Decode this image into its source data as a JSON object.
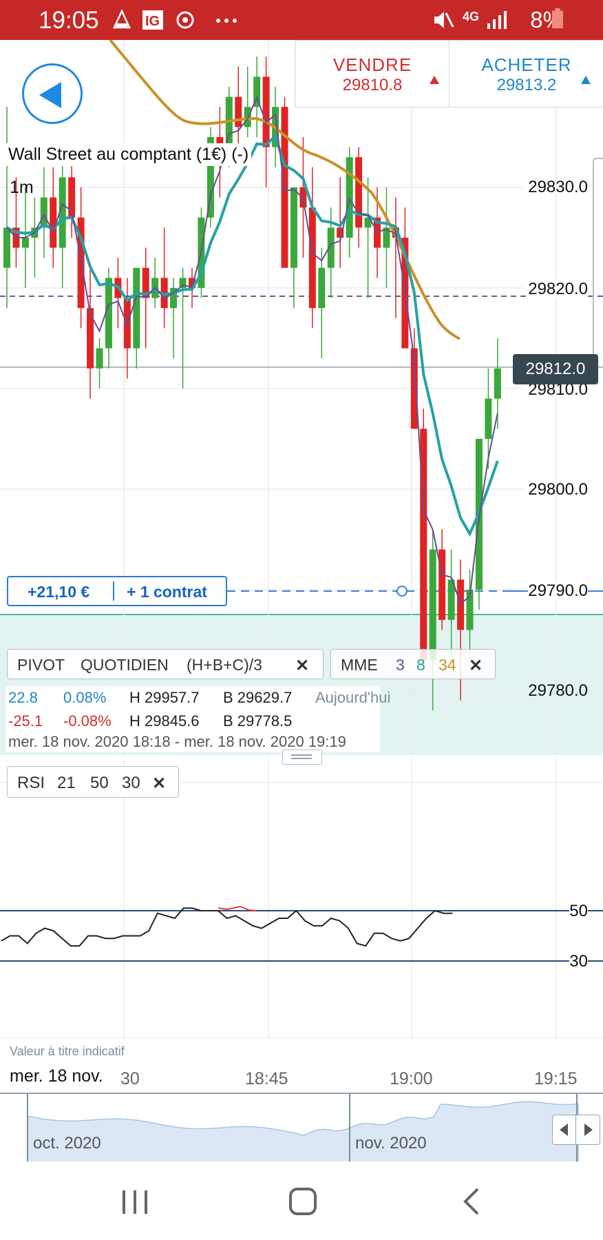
{
  "status_bar": {
    "time": "19:05",
    "app_badges": [
      "camera-icon",
      "ig-app-icon",
      "sync-icon",
      "more-dots-icon"
    ],
    "network": "4G",
    "battery": "8%"
  },
  "instrument": {
    "name": "Wall Street au comptant (1€) (-)",
    "timeframe": "1m"
  },
  "trade": {
    "sell_label": "VENDRE",
    "sell_price": "29810.8",
    "buy_label": "ACHETER",
    "buy_price": "29813.2",
    "sell_color": "#d32f2f",
    "buy_color": "#1e88c7"
  },
  "price_axis": {
    "labels": [
      "29830.0",
      "29820.0",
      "29810.0",
      "29800.0",
      "29790.0",
      "29780.0"
    ],
    "current_price": "29812.0"
  },
  "position": {
    "pnl": "+21,10 €",
    "size": "+ 1 contrat",
    "level": 29790.0
  },
  "indicators": {
    "pivot_label": "PIVOT",
    "pivot_type": "QUOTIDIEN",
    "pivot_formula": "(H+B+C)/3",
    "close_symbol": "✕",
    "mme_label": "MME",
    "mme_periods": [
      "3",
      "8",
      "34"
    ],
    "mme_colors": [
      "#6a4c93",
      "#26a1a6",
      "#c8922a"
    ]
  },
  "info_panel": {
    "row1": {
      "change": "22.8",
      "change_pct": "0.08%",
      "high": "H 29957.7",
      "low": "B 29629.7",
      "period": "Aujourd'hui"
    },
    "row2": {
      "change": "-25.1",
      "change_pct": "-0.08%",
      "high": "H 29845.6",
      "low": "B 29778.5"
    },
    "range": "mer. 18 nov. 2020 18:18 - mer. 18 nov. 2020 19:19"
  },
  "rsi": {
    "label": "RSI",
    "params": [
      "21",
      "50",
      "30"
    ],
    "levels": [
      "50",
      "30"
    ]
  },
  "disclaimer": "Valeur à titre indicatif",
  "time_axis": {
    "current_date": "mer. 18 nov.",
    "ticks": [
      ":30",
      "18:45",
      "19:00",
      "19:15"
    ]
  },
  "navigator": {
    "months": [
      "oct. 2020",
      "nov. 2020"
    ]
  },
  "system_nav": [
    "recent-apps-icon",
    "home-icon",
    "back-icon"
  ]
}
